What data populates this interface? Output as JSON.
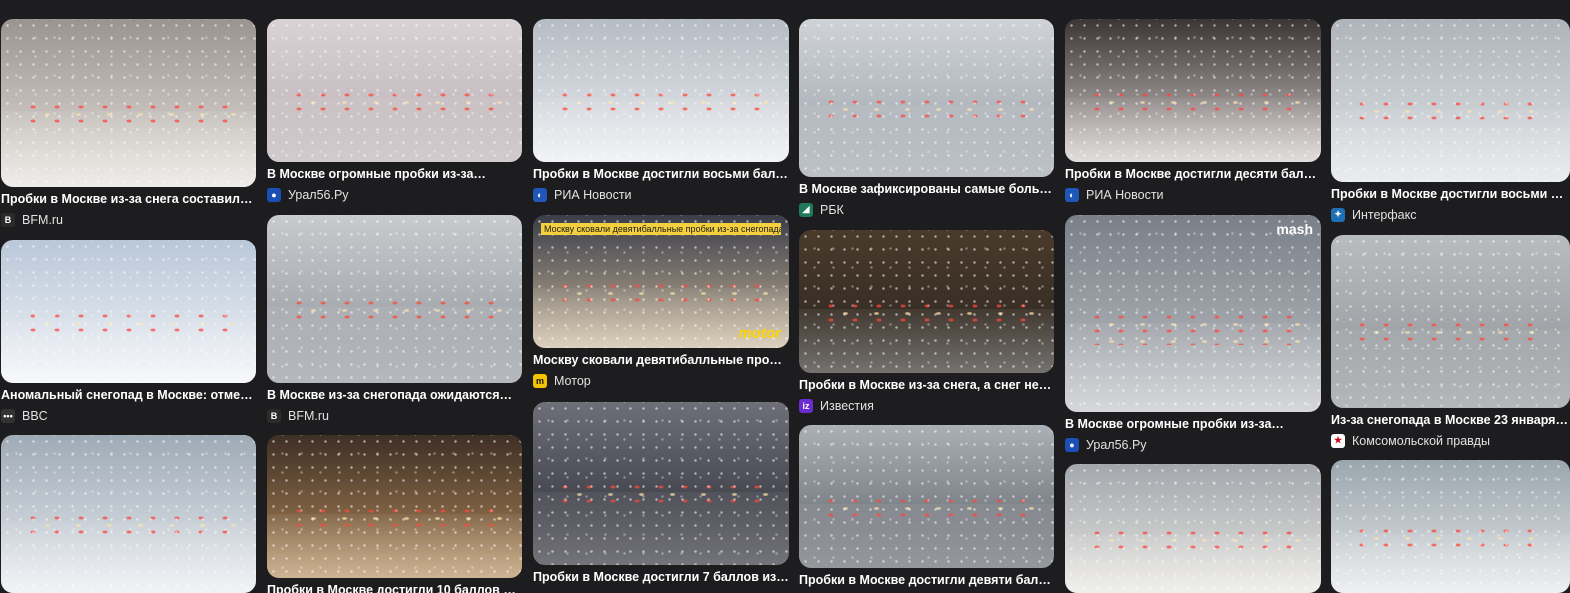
{
  "cards": [
    {
      "title": "Пробки в Москве из-за снега составили…",
      "source": "BFM.ru",
      "icon": "bfm-icon",
      "favicon_color": "#2b2b2b",
      "favicon_glyph": "B",
      "tint": [
        "#9a9490",
        "#e6e2dd"
      ]
    },
    {
      "title": "Аномальный снегопад в Москве: отмены…",
      "source": "BBC",
      "icon": "bbc-icon",
      "favicon_color": "#333333",
      "favicon_glyph": "•••",
      "tint": [
        "#b9c7d8",
        "#f2f4f8"
      ]
    },
    {
      "title": "",
      "source": "",
      "icon": "",
      "favicon_color": "",
      "favicon_glyph": "",
      "tint": [
        "#9eaab6",
        "#e9ecf0"
      ]
    },
    {
      "title": "В Москве огромные пробки из-за…",
      "source": "Урал56.Ру",
      "icon": "ural56-icon",
      "favicon_color": "#1a4fb5",
      "favicon_glyph": "●",
      "tint": [
        "#d9d2d4",
        "#b9b0b3"
      ]
    },
    {
      "title": "В Москве из-за снегопада ожидаются…",
      "source": "BFM.ru",
      "icon": "bfm-icon",
      "favicon_color": "#2b2b2b",
      "favicon_glyph": "B",
      "tint": [
        "#c8cacd",
        "#8e939a"
      ]
    },
    {
      "title": "Пробки в Москве достигли 10 баллов из…",
      "source": "",
      "icon": "",
      "favicon_color": "",
      "favicon_glyph": "",
      "tint": [
        "#3e2f25",
        "#b38a5a"
      ]
    },
    {
      "title": "Пробки в Москве достигли восьми балл…",
      "source": "РИА Новости",
      "icon": "ria-icon",
      "favicon_color": "#1f57b8",
      "favicon_glyph": "◐",
      "tint": [
        "#b6bcc4",
        "#e9ecef"
      ]
    },
    {
      "title": "Москву сковали девятибалльные пробк…",
      "source": "Мотор",
      "icon": "motor-icon",
      "favicon_color": "#f2c400",
      "favicon_glyph": "m",
      "tint": [
        "#3a3d48",
        "#c9b79a"
      ],
      "overlay": "Москву сковали девятибалльные пробки из-за снегопада",
      "brand": "motor"
    },
    {
      "title": "Пробки в Москве достигли 7 баллов из-…",
      "source": "",
      "icon": "",
      "favicon_color": "",
      "favicon_glyph": "",
      "tint": [
        "#6e6f78",
        "#2a2b33"
      ]
    },
    {
      "title": "В Москве зафиксированы самые больш…",
      "source": "РБК",
      "icon": "rbc-icon",
      "favicon_color": "#1e7a5a",
      "favicon_glyph": "◢",
      "tint": [
        "#cfd3d8",
        "#9aa1a9"
      ]
    },
    {
      "title": "Пробки в Москве из-за снега, а снег не…",
      "source": "Известия",
      "icon": "izvestia-icon",
      "favicon_color": "#6b2bd0",
      "favicon_glyph": "iz",
      "tint": [
        "#4a3a2a",
        "#2a2622"
      ]
    },
    {
      "title": "Пробки в Москве достигли девяти балло…",
      "source": "",
      "icon": "",
      "favicon_color": "",
      "favicon_glyph": "",
      "tint": [
        "#aab0b6",
        "#5e6168"
      ]
    },
    {
      "title": "Пробки в Москве достигли десяти балло…",
      "source": "РИА Новости",
      "icon": "ria-icon",
      "favicon_color": "#1f57b8",
      "favicon_glyph": "◐",
      "tint": [
        "#3b3535",
        "#d2cccb"
      ]
    },
    {
      "title": "В Москве огромные пробки из-за…",
      "source": "Урал56.Ру",
      "icon": "ural56-icon",
      "favicon_color": "#1a4fb5",
      "favicon_glyph": "●",
      "tint": [
        "#7a8088",
        "#bfc2c6"
      ],
      "brand": "mash"
    },
    {
      "title": "",
      "source": "",
      "icon": "",
      "favicon_color": "",
      "favicon_glyph": "",
      "tint": [
        "#a3a7ac",
        "#e8e6e2"
      ]
    },
    {
      "title": "Пробки в Москве достигли восьми балл…",
      "source": "Интерфакс",
      "icon": "interfax-icon",
      "favicon_color": "#1f6fb5",
      "favicon_glyph": "✦",
      "tint": [
        "#aeb4ba",
        "#dfe3e6"
      ]
    },
    {
      "title": "Из-за снегопада в Москве 23 января…",
      "source": "Комсомольской правды",
      "icon": "kp-icon",
      "favicon_color": "#ffffff",
      "favicon_glyph": "★",
      "tint": [
        "#b9bcbf",
        "#8d9195"
      ]
    },
    {
      "title": "",
      "source": "",
      "icon": "",
      "favicon_color": "",
      "favicon_glyph": "",
      "tint": [
        "#9aa5ad",
        "#e5e8ea"
      ]
    }
  ]
}
